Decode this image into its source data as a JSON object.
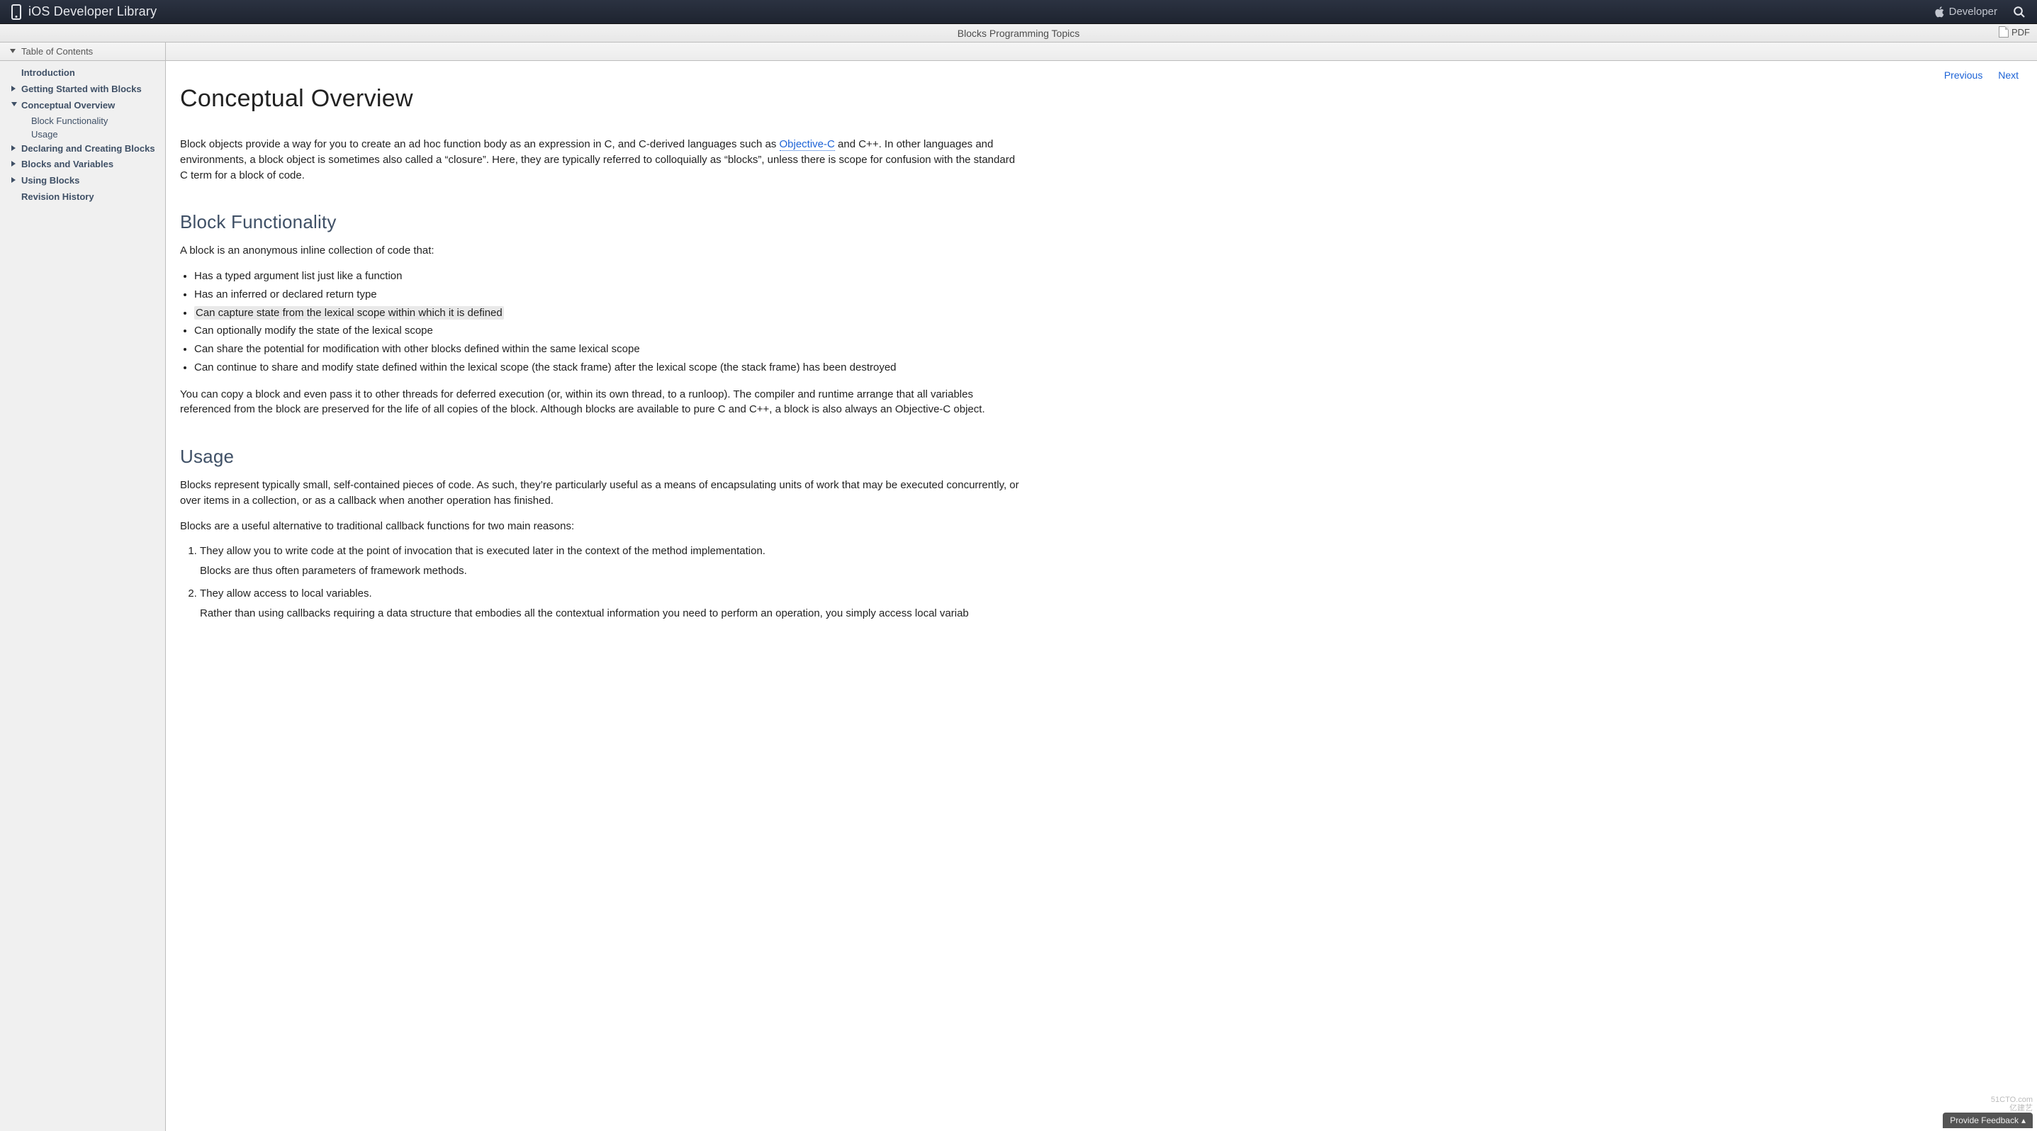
{
  "header": {
    "site_title": "iOS Developer Library",
    "developer_label": "Developer"
  },
  "subheader": {
    "doc_title": "Blocks Programming Topics",
    "pdf_label": "PDF"
  },
  "toc": {
    "header": "Table of Contents",
    "items": [
      {
        "label": "Introduction",
        "arrow": "none"
      },
      {
        "label": "Getting Started with Blocks",
        "arrow": "right"
      },
      {
        "label": "Conceptual Overview",
        "arrow": "down",
        "children": [
          {
            "label": "Block Functionality"
          },
          {
            "label": "Usage"
          }
        ]
      },
      {
        "label": "Declaring and Creating Blocks",
        "arrow": "right"
      },
      {
        "label": "Blocks and Variables",
        "arrow": "right"
      },
      {
        "label": "Using Blocks",
        "arrow": "right"
      },
      {
        "label": "Revision History",
        "arrow": "none"
      }
    ]
  },
  "pager": {
    "previous": "Previous",
    "next": "Next"
  },
  "article": {
    "title": "Conceptual Overview",
    "intro_before_link": "Block objects provide a way for you to create an ad hoc function body as an expression in C, and C-derived languages such as ",
    "intro_link_text": "Objective-C",
    "intro_after_link": " and C++. In other languages and environments, a block object is sometimes also called a “closure”. Here, they are typically referred to colloquially as “blocks”, unless there is scope for confusion with the standard C term for a block of code.",
    "section1": {
      "heading": "Block Functionality",
      "lead": "A block is an anonymous inline collection of code that:",
      "bullets": [
        "Has a typed argument list just like a function",
        "Has an inferred or declared return type",
        "Can capture state from the lexical scope within which it is defined",
        "Can optionally modify the state of the lexical scope",
        "Can share the potential for modification with other blocks defined within the same lexical scope",
        "Can continue to share and modify state defined within the lexical scope (the stack frame) after the lexical scope (the stack frame) has been destroyed"
      ],
      "post": "You can copy a block and even pass it to other threads for deferred execution (or, within its own thread, to a runloop). The compiler and runtime arrange that all variables referenced from the block are preserved for the life of all copies of the block. Although blocks are available to pure C and C++, a block is also always an Objective-C object."
    },
    "section2": {
      "heading": "Usage",
      "p1": "Blocks represent typically small, self-contained pieces of code. As such, they’re particularly useful as a means of encapsulating units of work that may be executed concurrently, or over items in a collection, or as a callback when another operation has finished.",
      "p2": "Blocks are a useful alternative to traditional callback functions for two main reasons:",
      "ordered": [
        {
          "main": "They allow you to write code at the point of invocation that is executed later in the context of the method implementation.",
          "sub": "Blocks are thus often parameters of framework methods."
        },
        {
          "main": "They allow access to local variables.",
          "sub": "Rather than using callbacks requiring a data structure that embodies all the contextual information you need to perform an operation, you simply access local variab"
        }
      ]
    }
  },
  "feedback": {
    "label": "Provide Feedback"
  },
  "watermark": {
    "line1": "51CTO.com",
    "line2": "亿建艺"
  }
}
